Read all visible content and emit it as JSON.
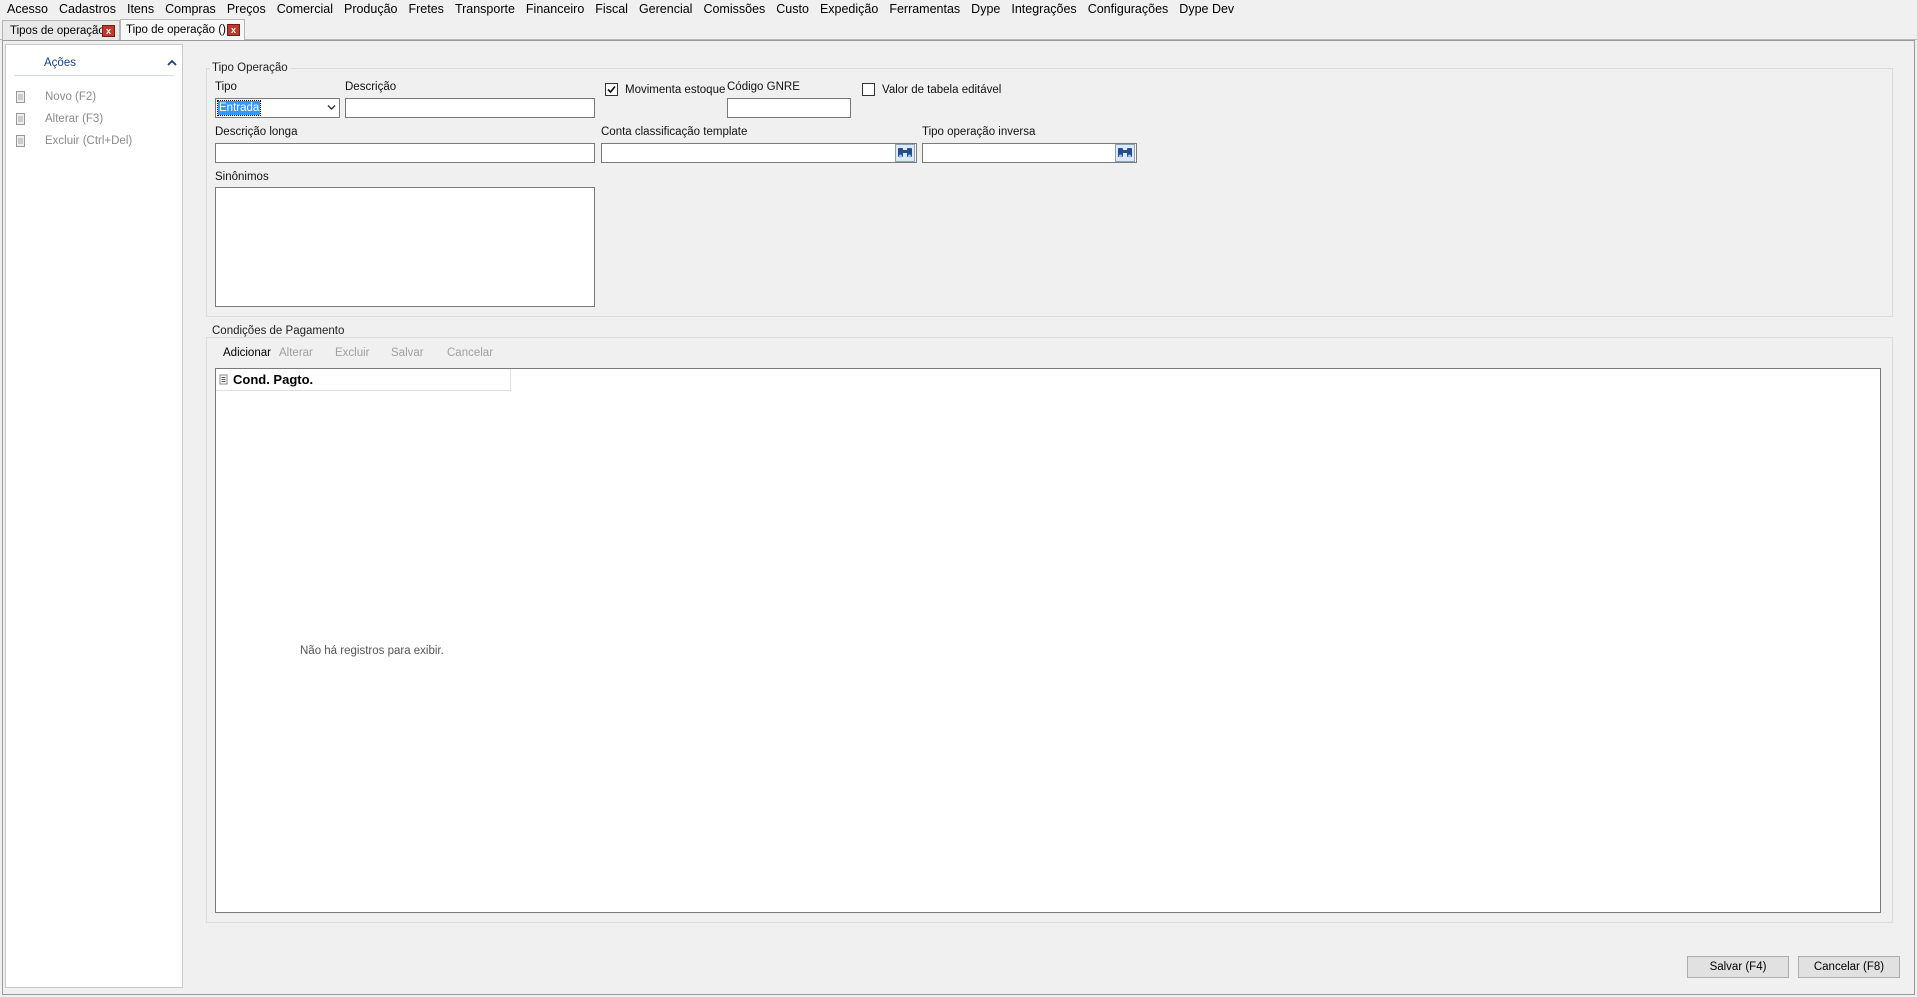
{
  "menu": [
    "Acesso",
    "Cadastros",
    "Itens",
    "Compras",
    "Preços",
    "Comercial",
    "Produção",
    "Fretes",
    "Transporte",
    "Financeiro",
    "Fiscal",
    "Gerencial",
    "Comissões",
    "Custo",
    "Expedição",
    "Ferramentas",
    "Dype",
    "Integrações",
    "Configurações",
    "Dype Dev"
  ],
  "tabs": [
    {
      "label": "Tipos de operação",
      "active": false
    },
    {
      "label": "Tipo de operação ()",
      "active": true
    }
  ],
  "actions": {
    "title": "Ações",
    "items": [
      "Novo (F2)",
      "Alterar (F3)",
      "Excluir (Ctrl+Del)"
    ]
  },
  "tipo_operacao": {
    "group_title": "Tipo Operação",
    "tipo_label": "Tipo",
    "tipo_value": "Entrada",
    "descricao_label": "Descrição",
    "descricao_value": "",
    "movimenta_estoque_label": "Movimenta estoque",
    "movimenta_estoque_checked": true,
    "codigo_gnre_label": "Código GNRE",
    "codigo_gnre_value": "",
    "valor_tabela_label": "Valor de tabela editável",
    "valor_tabela_checked": false,
    "descricao_longa_label": "Descrição longa",
    "conta_label": "Conta classificação template",
    "tipo_inversa_label": "Tipo operação inversa",
    "sinonimos_label": "Sinônimos"
  },
  "condicoes": {
    "group_title": "Condições de Pagamento",
    "toolbar": [
      {
        "label": "Adicionar",
        "enabled": true
      },
      {
        "label": "Alterar",
        "enabled": false
      },
      {
        "label": "Excluir",
        "enabled": false
      },
      {
        "label": "Salvar",
        "enabled": false
      },
      {
        "label": "Cancelar",
        "enabled": false
      }
    ],
    "column": "Cond. Pagto.",
    "empty_message": "Não há registros para exibir."
  },
  "buttons": {
    "save": "Salvar (F4)",
    "cancel": "Cancelar (F8)"
  },
  "colors": {
    "accent": "#15428b",
    "selection": "#3399ff",
    "close": "#c0392b"
  }
}
